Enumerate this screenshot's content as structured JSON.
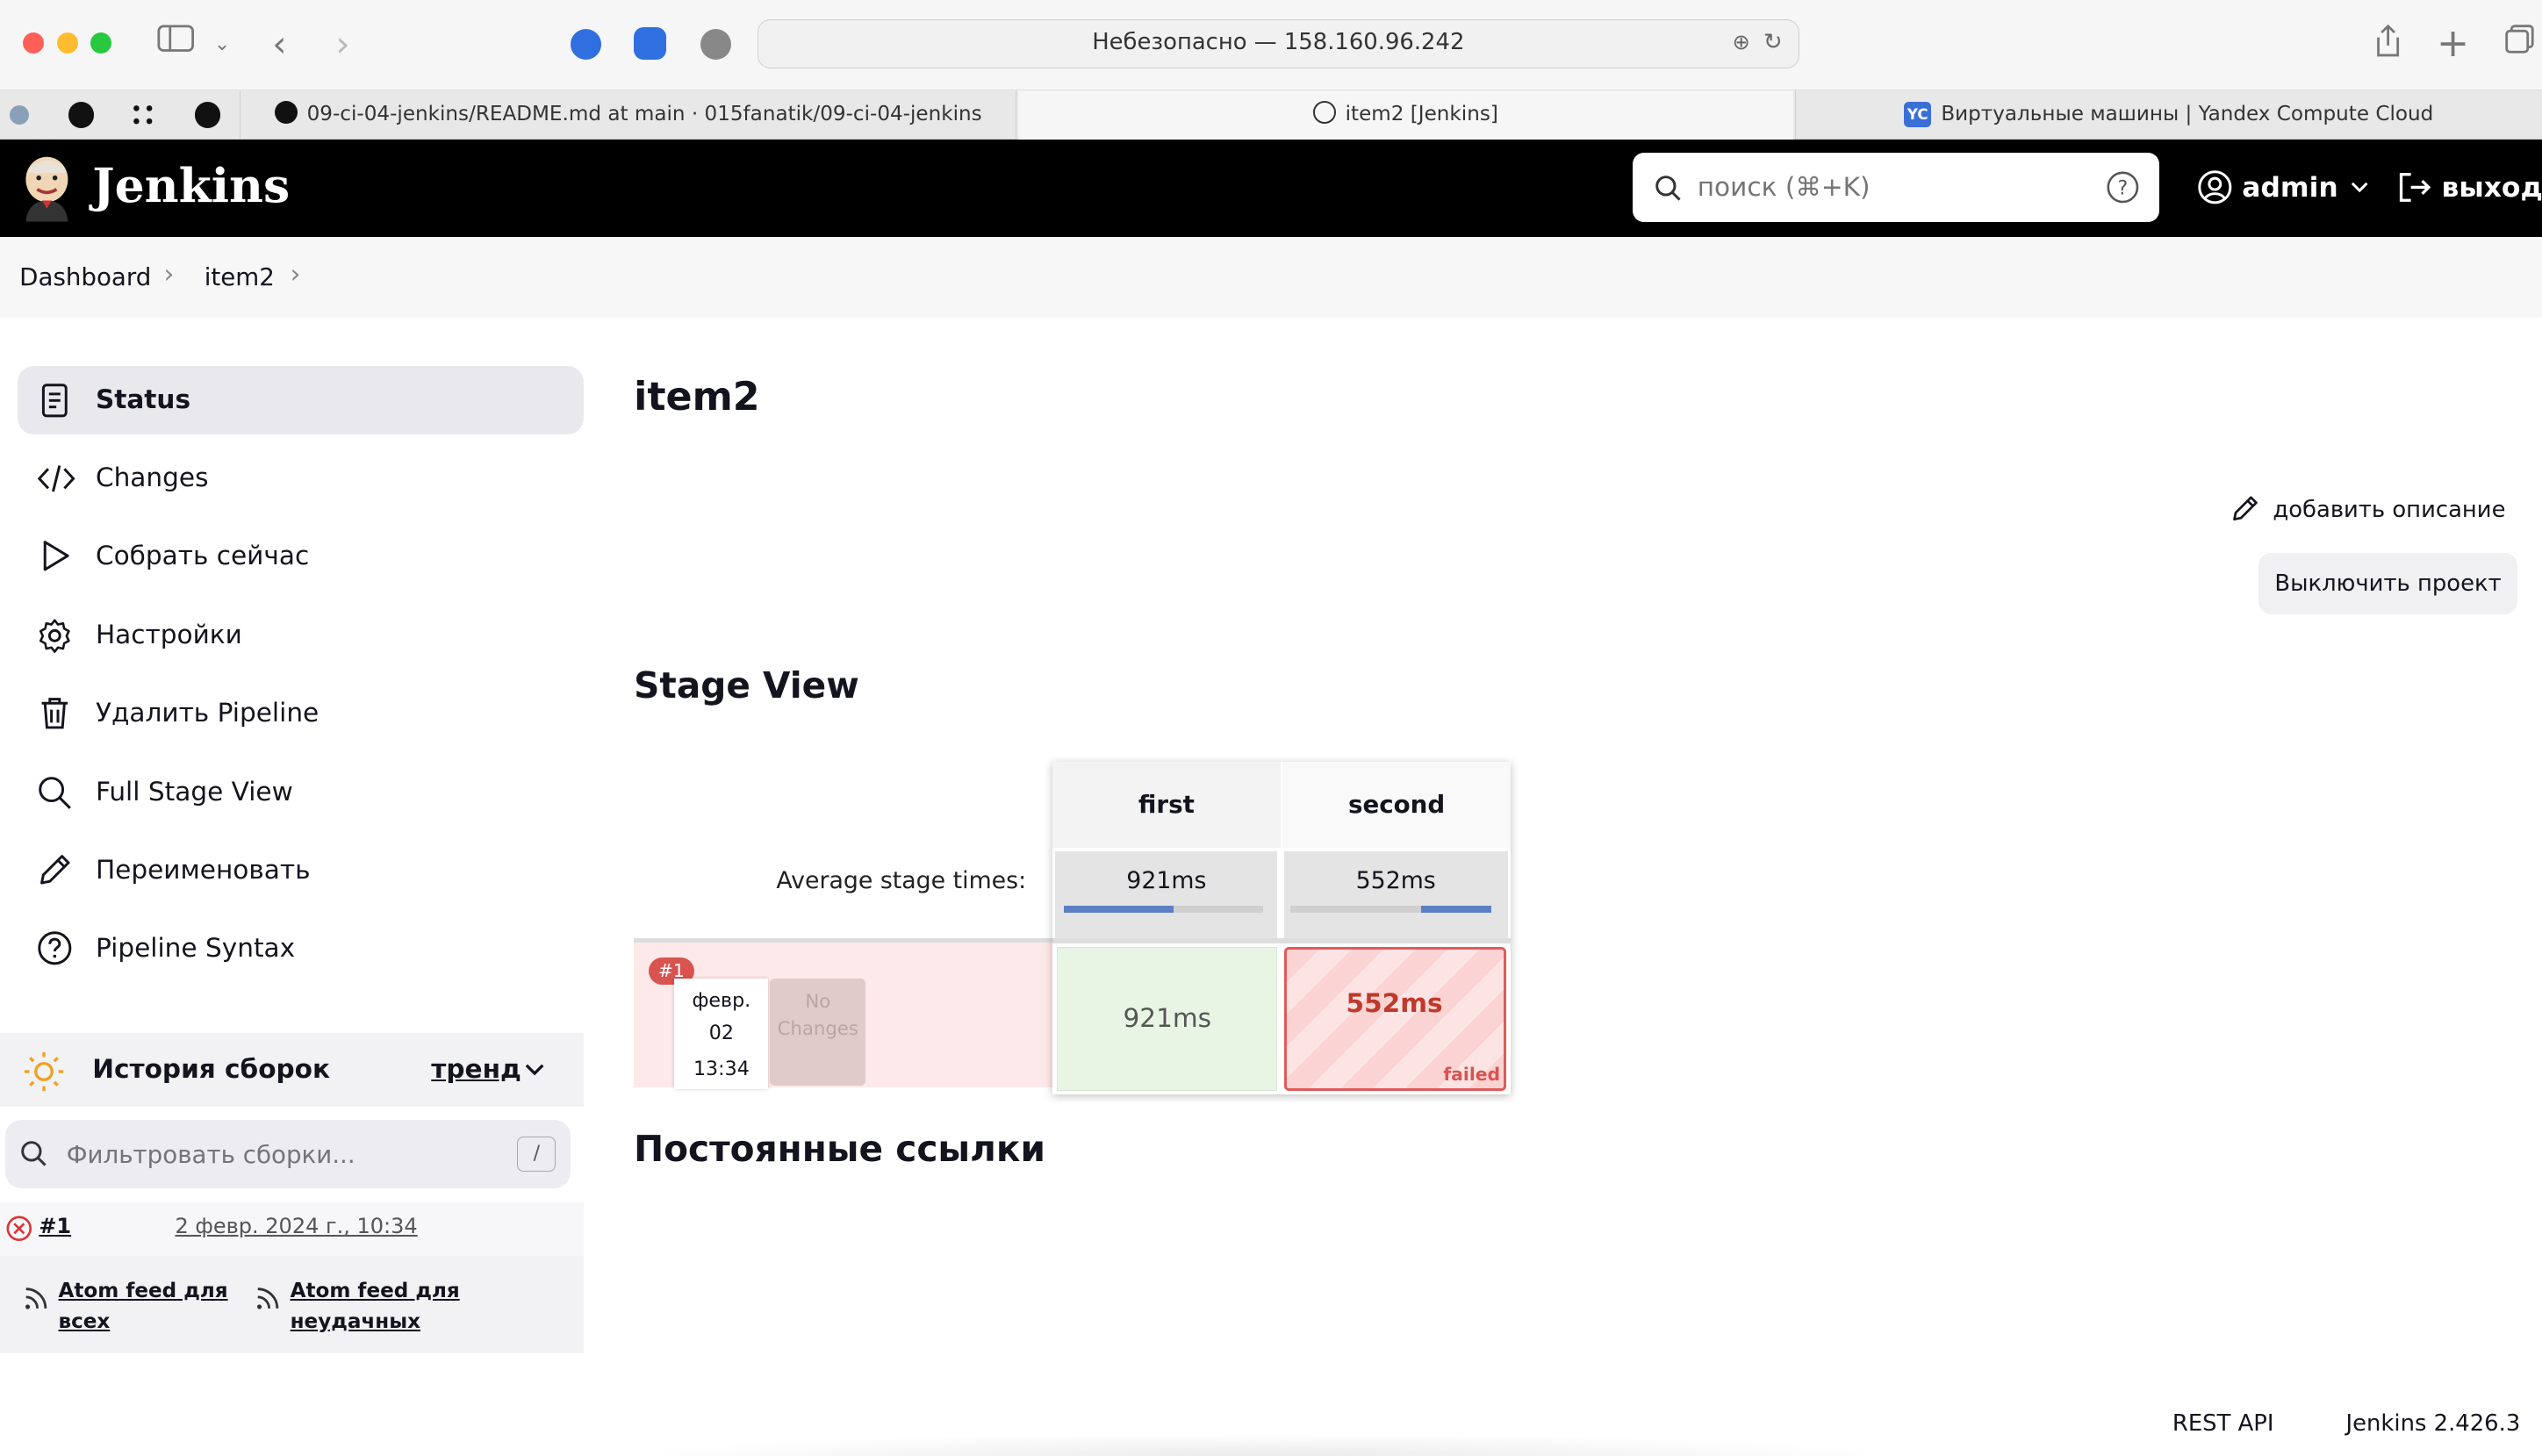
{
  "browser": {
    "address": "Небезопасно — 158.160.96.242",
    "tabs": [
      {
        "title": "09-ci-04-jenkins/README.md at main · 015fanatik/09-ci-04-jenkins"
      },
      {
        "title": "item2 [Jenkins]"
      },
      {
        "title": "Виртуальные машины | Yandex Compute Cloud",
        "badge": "YC"
      }
    ]
  },
  "header": {
    "brand": "Jenkins",
    "search_placeholder": "поиск (⌘+K)",
    "user": "admin",
    "logout": "выход"
  },
  "breadcrumb": [
    "Dashboard",
    "item2"
  ],
  "sidebar": {
    "items": [
      {
        "label": "Status",
        "icon": "document-icon"
      },
      {
        "label": "Changes",
        "icon": "code-icon"
      },
      {
        "label": "Собрать сейчас",
        "icon": "play-icon"
      },
      {
        "label": "Настройки",
        "icon": "gear-icon"
      },
      {
        "label": "Удалить Pipeline",
        "icon": "trash-icon"
      },
      {
        "label": "Full Stage View",
        "icon": "search-icon"
      },
      {
        "label": "Переименовать",
        "icon": "pencil-icon"
      },
      {
        "label": "Pipeline Syntax",
        "icon": "help-icon"
      }
    ],
    "history": {
      "title": "История сборок",
      "trend": "тренд",
      "filter_placeholder": "Фильтровать сборки...",
      "filter_shortcut": "/",
      "builds": [
        {
          "number": "#1",
          "date": "2 февр. 2024 г., 10:34",
          "status": "failed"
        }
      ],
      "feeds": {
        "all": "Atom feed для всех",
        "failed": "Atom feed для неудачных"
      }
    }
  },
  "main": {
    "title": "item2",
    "add_description": "добавить описание",
    "disable_project": "Выключить проект",
    "stage_view_title": "Stage View",
    "permalinks_title": "Постоянные ссылки",
    "stage_view": {
      "stages": [
        "first",
        "second"
      ],
      "average_label": "Average stage times:",
      "averages": [
        "921ms",
        "552ms"
      ],
      "average_progress": [
        0.55,
        0.35
      ],
      "run": {
        "badge": "#1",
        "month": "февр.",
        "day": "02",
        "time": "13:34",
        "changes": "No Changes",
        "cells": [
          {
            "duration": "921ms",
            "status": "success"
          },
          {
            "duration": "552ms",
            "status": "failed",
            "label": "failed"
          }
        ]
      }
    }
  },
  "footer": {
    "rest_api": "REST API",
    "version": "Jenkins 2.426.3"
  },
  "colors": {
    "failed": "#c0392b",
    "success_bg": "#e9f5e4",
    "failed_bg": "#fde1e1",
    "accent": "#5b7fc7"
  }
}
